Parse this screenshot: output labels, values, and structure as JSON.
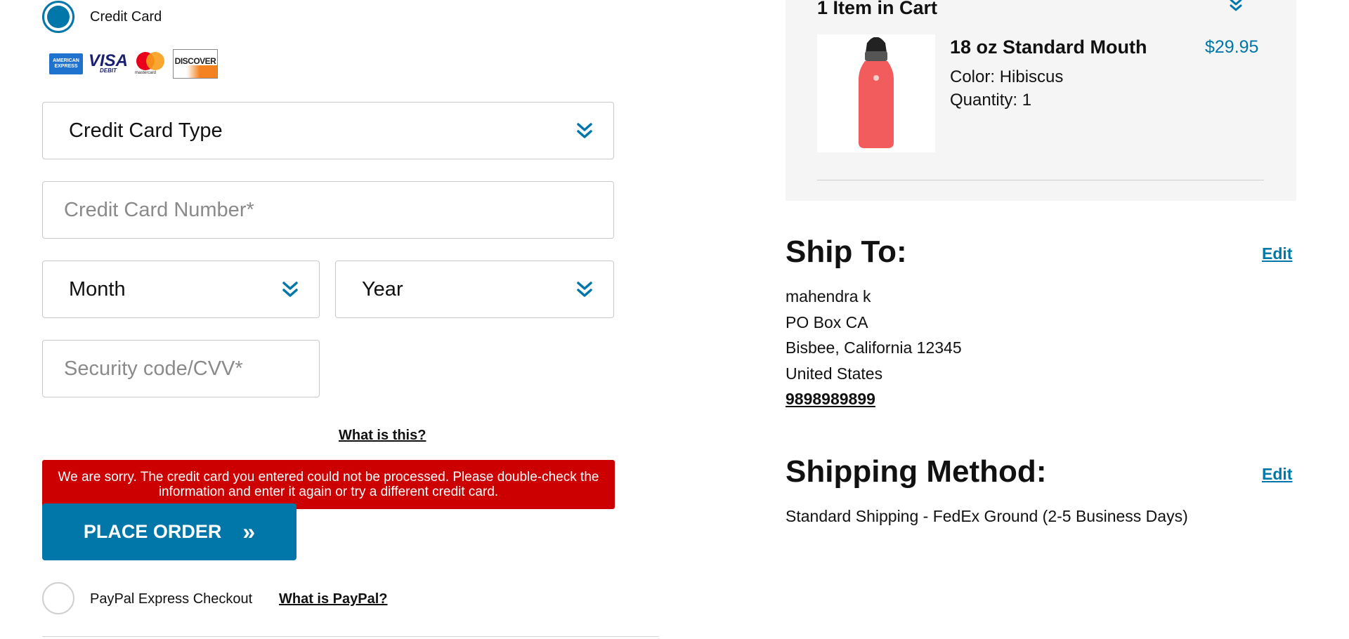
{
  "payment": {
    "credit_card_label": "Credit Card",
    "card_logos": [
      {
        "name": "amex",
        "text": "AMERICAN EXPRESS"
      },
      {
        "name": "visa",
        "text": "VISA",
        "sub": "DEBIT"
      },
      {
        "name": "mastercard",
        "text": "mastercard"
      },
      {
        "name": "discover",
        "text": "DISCOVER"
      }
    ],
    "card_type_select": "Credit Card Type",
    "card_number_placeholder": "Credit Card Number*",
    "month_select": "Month",
    "year_select": "Year",
    "cvv_placeholder": "Security code/CVV*",
    "what_is_this_link": "What is this?",
    "error_message": "We are sorry. The credit card you entered could not be processed. Please double-check the information and enter it again or try a different credit card.",
    "place_order_label": "PLACE ORDER",
    "place_order_arrow": "»",
    "paypal_label": "PayPal Express Checkout",
    "paypal_link": "What is PayPal?"
  },
  "cart": {
    "title": "1 Item in Cart",
    "item": {
      "name": "18 oz Standard Mouth",
      "price": "$29.95",
      "color": "Color: Hibiscus",
      "quantity": "Quantity: 1"
    }
  },
  "ship_to": {
    "title": "Ship To:",
    "edit": "Edit",
    "name": "mahendra k",
    "line1": "PO Box CA",
    "line2": "Bisbee, California 12345",
    "country": "United States",
    "phone": "9898989899"
  },
  "shipping_method": {
    "title": "Shipping Method:",
    "edit": "Edit",
    "value": "Standard Shipping - FedEx Ground (2-5 Business Days)"
  },
  "colors": {
    "accent": "#0077a8",
    "error": "#cc0000",
    "product": "#f25c5c"
  },
  "icons": [
    "chevron-double-down-icon",
    "water-bottle-image"
  ]
}
